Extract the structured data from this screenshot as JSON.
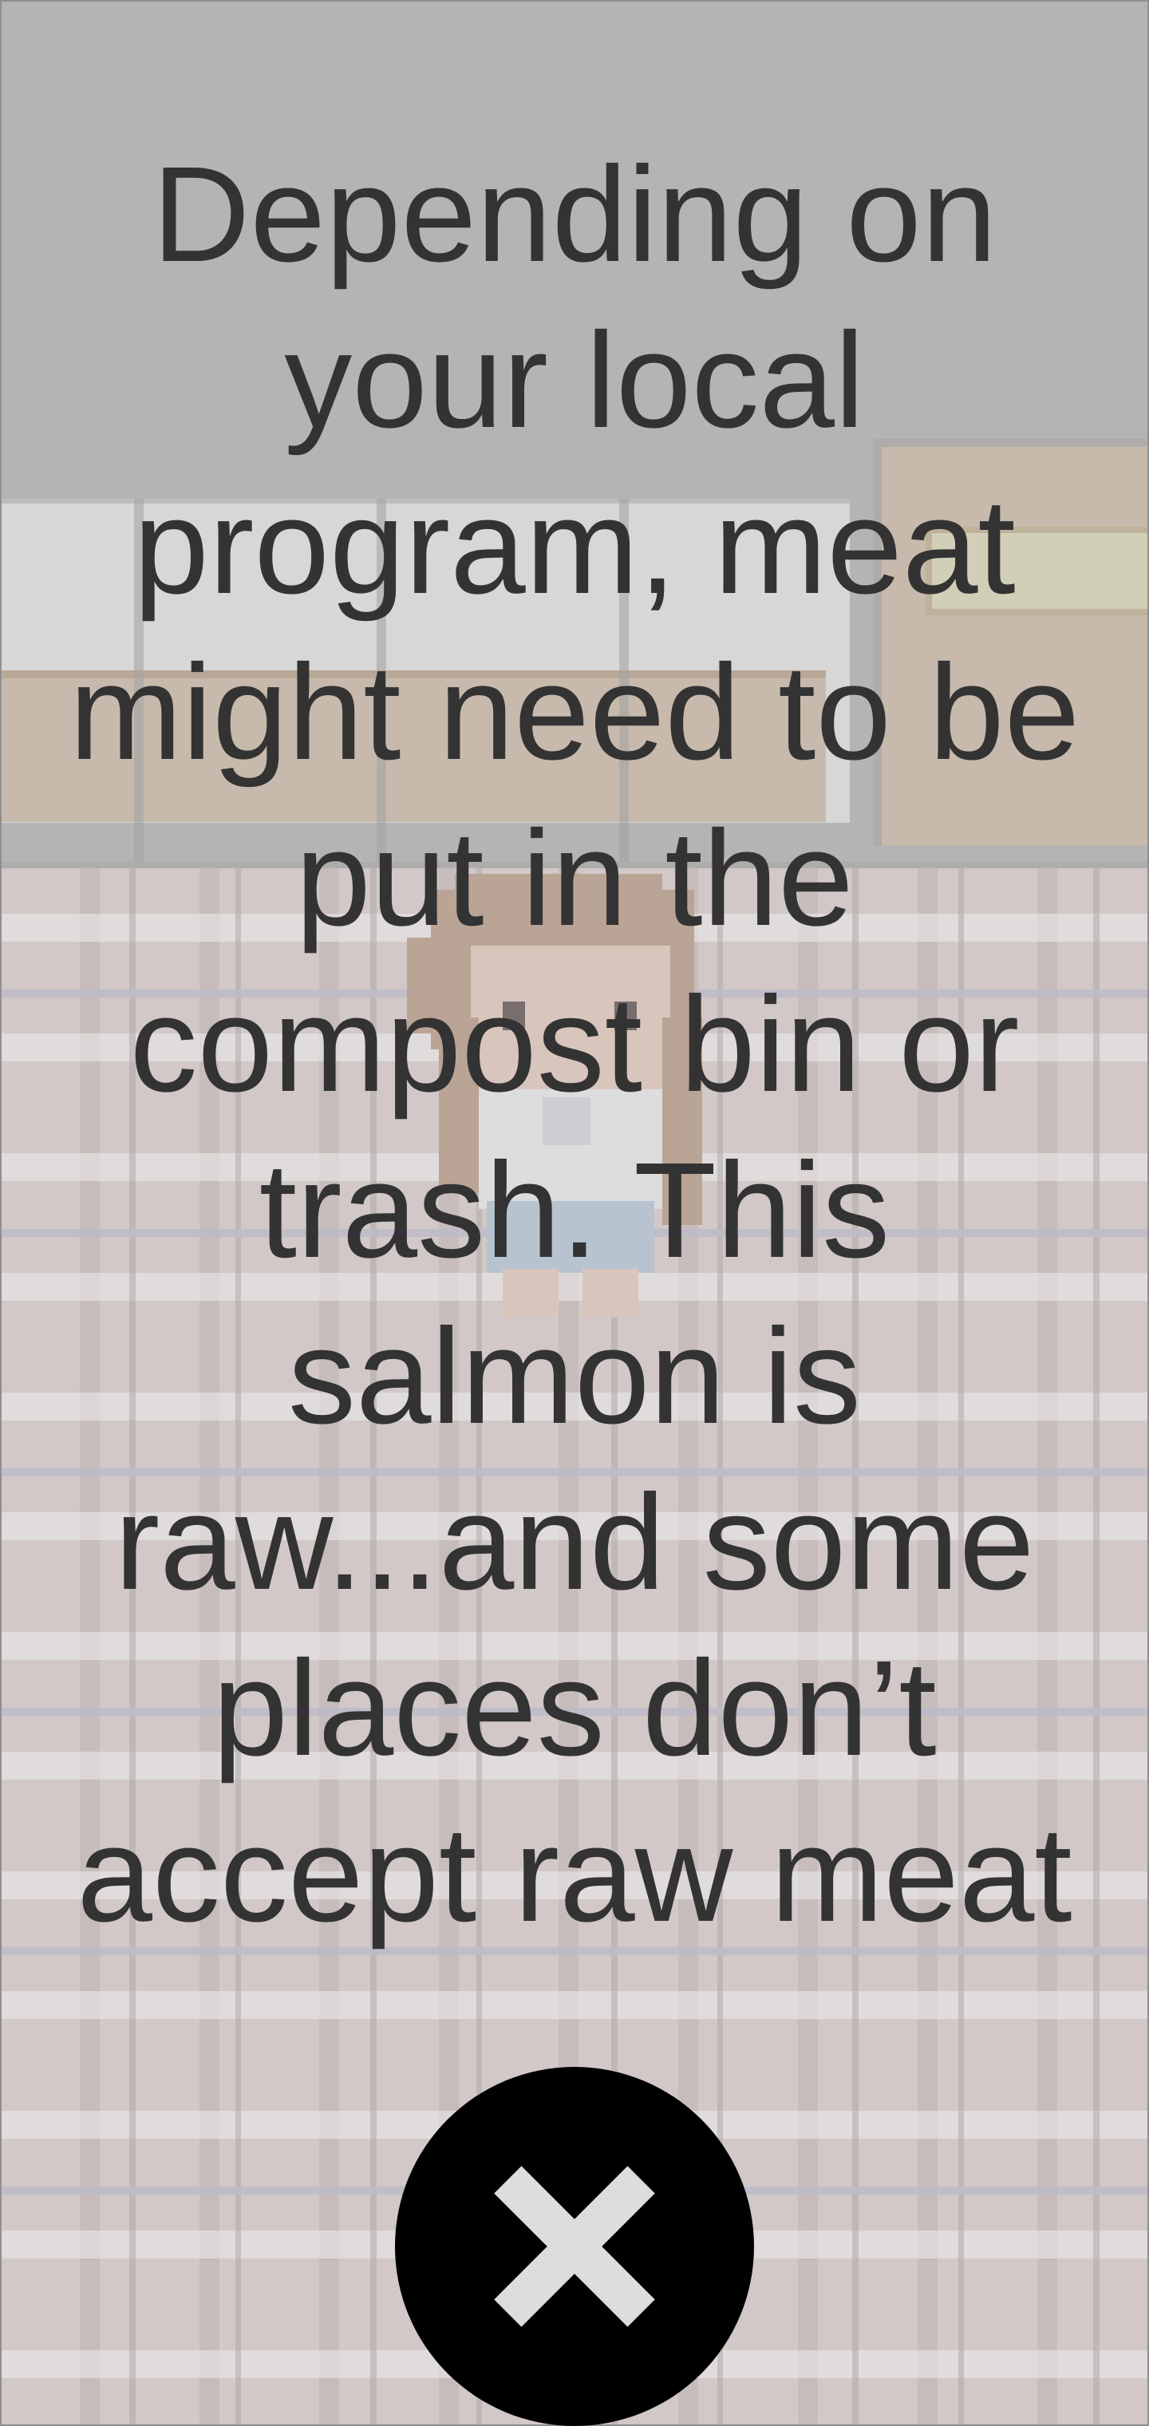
{
  "dialog": {
    "message": "Depending on your local program, meat might need to be put in the compost bin or trash. This salmon is raw...and some places don’t accept raw meat",
    "close_icon": "close-icon"
  },
  "colors": {
    "text": "#333333",
    "close_button_bg": "#000000",
    "close_icon": "#dddddd"
  }
}
